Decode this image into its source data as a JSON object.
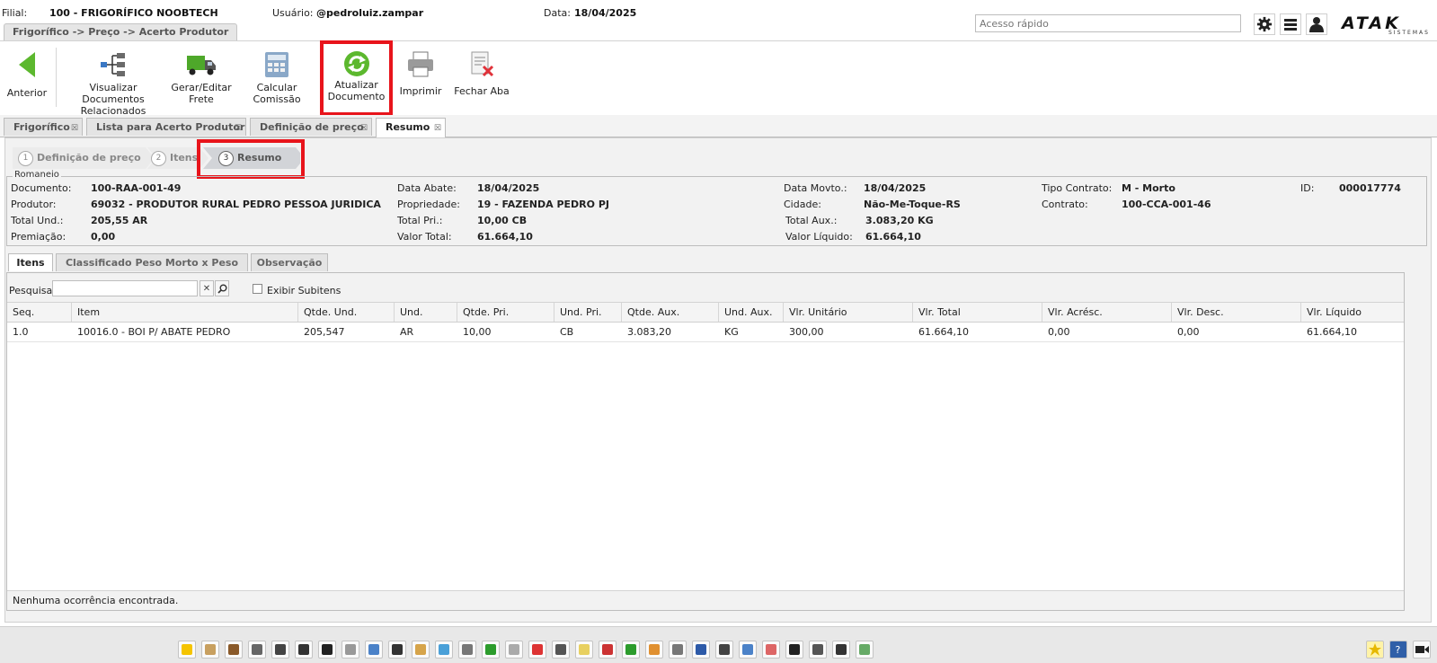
{
  "header": {
    "filial_label": "Filial:",
    "filial_value": "100 - FRIGORÍFICO NOOBTECH",
    "usuario_label": "Usuário:",
    "usuario_value": "@pedroluiz.zampar",
    "data_label": "Data:",
    "data_value": "18/04/2025",
    "breadcrumb": "Frigorífico -> Preço -> Acerto Produtor",
    "quick_access_placeholder": "Acesso rápido",
    "logo": "ATAK",
    "logo_sub": "SISTEMAS"
  },
  "toolbar": {
    "anterior": "Anterior",
    "visualizar": "Visualizar Documentos\nRelacionados",
    "gerar_frete": "Gerar/Editar\nFrete",
    "calcular": "Calcular Comissão",
    "atualizar": "Atualizar\nDocumento",
    "imprimir": "Imprimir",
    "fechar": "Fechar Aba"
  },
  "tabs": [
    "Frigorífico",
    "Lista para Acerto Produtor",
    "Definição de preço",
    "Resumo"
  ],
  "steps": [
    {
      "num": "1",
      "label": "Definição de preço"
    },
    {
      "num": "2",
      "label": "Itens"
    },
    {
      "num": "3",
      "label": "Resumo"
    }
  ],
  "romaneio": {
    "legend": "Romaneio",
    "documento_label": "Documento:",
    "documento": "100-RAA-001-49",
    "produtor_label": "Produtor:",
    "produtor": "69032 - PRODUTOR RURAL PEDRO PESSOA JURIDICA",
    "total_und_label": "Total Und.:",
    "total_und": "205,55 AR",
    "premiacao_label": "Premiação:",
    "premiacao": "0,00",
    "data_abate_label": "Data Abate:",
    "data_abate": "18/04/2025",
    "propriedade_label": "Propriedade:",
    "propriedade": "19 - FAZENDA PEDRO PJ",
    "total_pri_label": "Total Pri.:",
    "total_pri": "10,00 CB",
    "valor_total_label": "Valor Total:",
    "valor_total": "61.664,10",
    "data_movto_label": "Data Movto.:",
    "data_movto": "18/04/2025",
    "cidade_label": "Cidade:",
    "cidade": "Não-Me-Toque-RS",
    "total_aux_label": "Total Aux.:",
    "total_aux": "3.083,20 KG",
    "valor_liquido_label": "Valor Líquido:",
    "valor_liquido": "61.664,10",
    "tipo_contrato_label": "Tipo Contrato:",
    "tipo_contrato": "M - Morto",
    "contrato_label": "Contrato:",
    "contrato": "100-CCA-001-46",
    "id_label": "ID:",
    "id": "000017774"
  },
  "subtabs": [
    "Itens",
    "Classificado Peso Morto x Peso Vivo",
    "Observação"
  ],
  "grid": {
    "search_label": "Pesquisar",
    "exibir_subitens": "Exibir Subitens",
    "columns": [
      "Seq.",
      "Item",
      "Qtde. Und.",
      "Und.",
      "Qtde. Pri.",
      "Und. Pri.",
      "Qtde. Aux.",
      "Und. Aux.",
      "Vlr. Unitário",
      "Vlr. Total",
      "Vlr. Acrésc.",
      "Vlr. Desc.",
      "Vlr. Líquido"
    ],
    "rows": [
      [
        "1.0",
        "10016.0 - BOI P/ ABATE PEDRO",
        "205,547",
        "AR",
        "10,00",
        "CB",
        "3.083,20",
        "KG",
        "300,00",
        "61.664,10",
        "0,00",
        "0,00",
        "61.664,10"
      ]
    ],
    "footer": "Nenhuma ocorrência encontrada."
  },
  "colors": {
    "highlight": "#e8141b",
    "accent_green": "#5cb82e"
  }
}
